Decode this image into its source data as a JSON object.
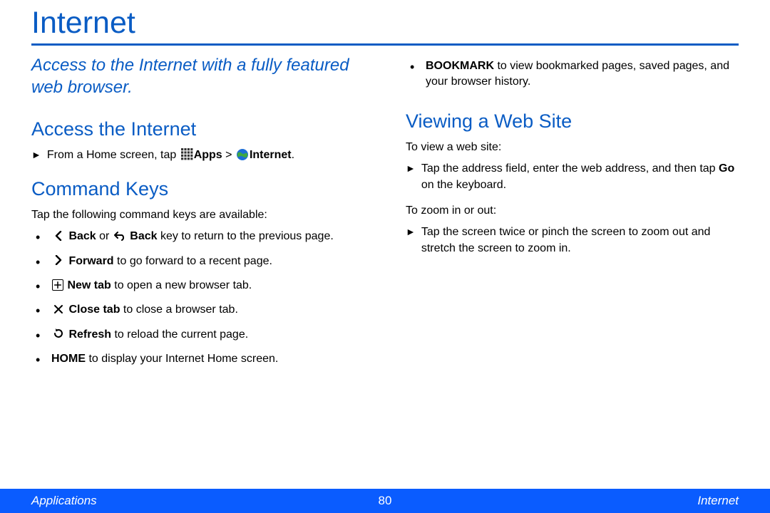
{
  "title": "Internet",
  "intro": "Access to the Internet with a fully featured web browser.",
  "left": {
    "access_heading": "Access the Internet",
    "access_step_pre": "From a Home screen, tap ",
    "access_apps_label": "Apps",
    "access_gt": " > ",
    "access_internet_label": "Internet",
    "command_heading": "Command Keys",
    "command_intro": "Tap the following command keys are available:",
    "items": {
      "back_bold1": "Back",
      "back_mid": " or ",
      "back_bold2": "Back",
      "back_tail": " key to return to the previous page.",
      "forward_bold": "Forward",
      "forward_tail": " to go forward to a recent page.",
      "newtab_bold": "New tab",
      "newtab_tail": " to open a new browser tab.",
      "closetab_bold": "Close tab",
      "closetab_tail": " to close a browser tab.",
      "refresh_bold": "Refresh",
      "refresh_tail": " to reload the current page.",
      "home_bold": "HOME",
      "home_tail": " to display your Internet Home screen."
    }
  },
  "right": {
    "bookmark_bold": "BOOKMARK",
    "bookmark_tail": " to view bookmarked pages, saved pages, and your browser history.",
    "viewing_heading": "Viewing a Web Site",
    "view_intro": "To view a web site:",
    "view_step1_part1": "Tap the address field, enter the web address, and then tap ",
    "view_step1_bold": "Go",
    "view_step1_part2": " on the keyboard.",
    "zoom_intro": "To zoom in or out:",
    "zoom_step": "Tap the screen twice or pinch the screen to zoom out and stretch the screen to zoom in."
  },
  "footer": {
    "left": "Applications",
    "center": "80",
    "right": "Internet"
  }
}
